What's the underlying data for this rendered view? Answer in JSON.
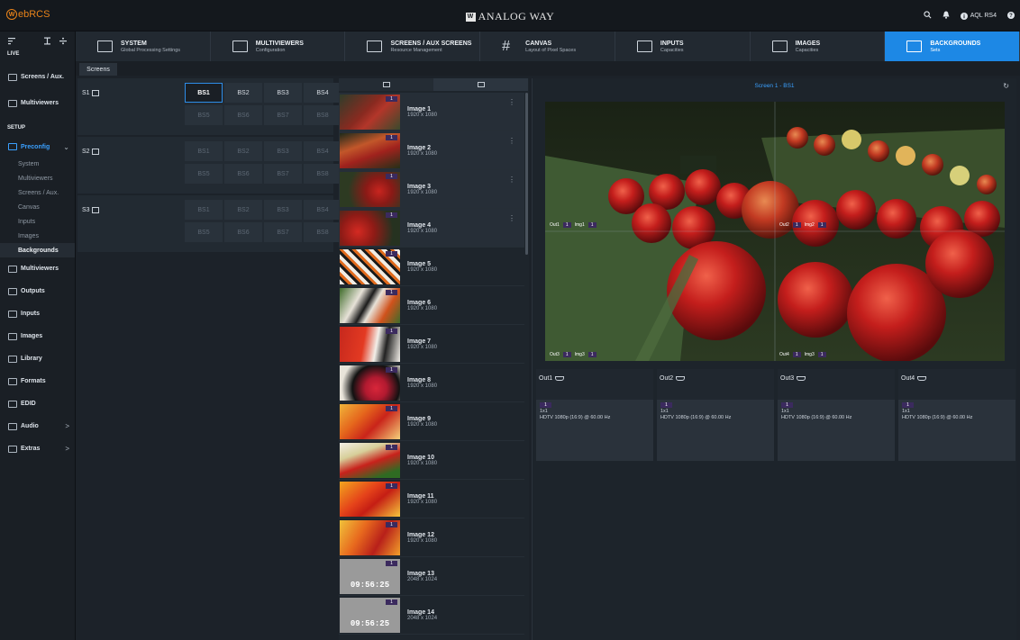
{
  "app": {
    "logo_letter": "W",
    "logo_rest": "ebRCS",
    "brand_mark": "W",
    "brand": "ANALOG WAY",
    "device": "AQL RS4"
  },
  "sidebar": {
    "live_label": "LIVE",
    "setup_label": "SETUP",
    "live_items": [
      {
        "label": "Screens / Aux."
      },
      {
        "label": "Multiviewers"
      }
    ],
    "preconfig": {
      "label": "Preconfig",
      "chevron": "⌄"
    },
    "sub_items": [
      "System",
      "Multiviewers",
      "Screens / Aux.",
      "Canvas",
      "Inputs",
      "Images",
      "Backgrounds"
    ],
    "setup_items": [
      {
        "label": "Multiviewers",
        "chevron": ""
      },
      {
        "label": "Outputs",
        "chevron": ""
      },
      {
        "label": "Inputs",
        "chevron": ""
      },
      {
        "label": "Images",
        "chevron": ""
      },
      {
        "label": "Library",
        "chevron": ""
      },
      {
        "label": "Formats",
        "chevron": ""
      },
      {
        "label": "EDID",
        "chevron": ""
      },
      {
        "label": "Audio",
        "chevron": ">"
      },
      {
        "label": "Extras",
        "chevron": ">"
      }
    ]
  },
  "nav_tabs": [
    {
      "title": "SYSTEM",
      "subtitle": "Global Processing Settings"
    },
    {
      "title": "MULTIVIEWERS",
      "subtitle": "Configuration"
    },
    {
      "title": "SCREENS / AUX SCREENS",
      "subtitle": "Resource Management"
    },
    {
      "title": "CANVAS",
      "subtitle": "Layout of Pixel Spaces"
    },
    {
      "title": "INPUTS",
      "subtitle": "Capacities"
    },
    {
      "title": "IMAGES",
      "subtitle": "Capacities"
    },
    {
      "title": "BACKGROUNDS",
      "subtitle": "Sets"
    }
  ],
  "screens_tab": "Screens",
  "screens": [
    {
      "label": "S1",
      "sets": [
        "BS1",
        "BS2",
        "BS3",
        "BS4",
        "BS5",
        "BS6",
        "BS7",
        "BS8"
      ]
    },
    {
      "label": "S2",
      "sets": [
        "BS1",
        "BS2",
        "BS3",
        "BS4",
        "BS5",
        "BS6",
        "BS7",
        "BS8"
      ]
    },
    {
      "label": "S3",
      "sets": [
        "BS1",
        "BS2",
        "BS3",
        "BS4",
        "BS5",
        "BS6",
        "BS7",
        "BS8"
      ]
    }
  ],
  "images": [
    {
      "name": "Image 1",
      "res": "1920 x 1080",
      "badge": "1"
    },
    {
      "name": "Image 2",
      "res": "1920 x 1080",
      "badge": "1"
    },
    {
      "name": "Image 3",
      "res": "1920 x 1080",
      "badge": "1"
    },
    {
      "name": "Image 4",
      "res": "1920 x 1080",
      "badge": "1"
    },
    {
      "name": "Image 5",
      "res": "1920 x 1080",
      "badge": "1"
    },
    {
      "name": "Image 6",
      "res": "1920 x 1080",
      "badge": "1"
    },
    {
      "name": "Image 7",
      "res": "1920 x 1080",
      "badge": "1"
    },
    {
      "name": "Image 8",
      "res": "1920 x 1080",
      "badge": "1"
    },
    {
      "name": "Image 9",
      "res": "1920 x 1080",
      "badge": "1"
    },
    {
      "name": "Image 10",
      "res": "1920 x 1080",
      "badge": "1"
    },
    {
      "name": "Image 11",
      "res": "1920 x 1080",
      "badge": "1"
    },
    {
      "name": "Image 12",
      "res": "1920 x 1080",
      "badge": "1"
    },
    {
      "name": "Image 13",
      "res": "2048 x 1024",
      "badge": "1",
      "clock": "09:56:25"
    },
    {
      "name": "Image 14",
      "res": "2048 x 1024",
      "badge": "1",
      "clock": "09:56:25"
    }
  ],
  "preview": {
    "title": "Screen 1 - BS1",
    "tags": [
      {
        "out": "Out1",
        "n": "1",
        "img": "Img1",
        "m": "1"
      },
      {
        "out": "Out2",
        "n": "1",
        "img": "Img2",
        "m": "1"
      },
      {
        "out": "Out3",
        "n": "1",
        "img": "Img3",
        "m": "1"
      },
      {
        "out": "Out4",
        "n": "1",
        "img": "Img3",
        "m": "1"
      }
    ]
  },
  "outputs": [
    {
      "label": "Out1",
      "badge": "1",
      "layout": "1x1",
      "format": "HDTV 1080p (16:9) @ 60.00 Hz"
    },
    {
      "label": "Out2",
      "badge": "1",
      "layout": "1x1",
      "format": "HDTV 1080p (16:9) @ 60.00 Hz"
    },
    {
      "label": "Out3",
      "badge": "1",
      "layout": "1x1",
      "format": "HDTV 1080p (16:9) @ 60.00 Hz"
    },
    {
      "label": "Out4",
      "badge": "1",
      "layout": "1x1",
      "format": "HDTV 1080p (16:9) @ 60.00 Hz"
    }
  ],
  "colors": {
    "accent": "#1d88e5",
    "badge": "#3b2a5e",
    "logo": "#e8831a"
  }
}
